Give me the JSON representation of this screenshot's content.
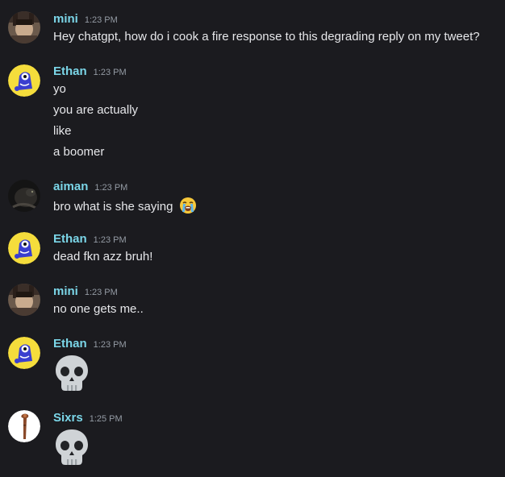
{
  "messages": [
    {
      "author": "mini",
      "avatar": "mini-avatar",
      "time": "1:23 PM",
      "lines": [
        "Hey chatgpt, how do i cook a fire response to this degrading reply on my tweet?"
      ]
    },
    {
      "author": "Ethan",
      "avatar": "ethan-avatar",
      "time": "1:23 PM",
      "lines": [
        "yo",
        "you are actually",
        "like",
        "a boomer"
      ]
    },
    {
      "author": "aiman",
      "avatar": "aiman-avatar",
      "time": "1:23 PM",
      "lines": [
        "bro what is she saying"
      ],
      "emoji": "loudly-crying-face-emoji"
    },
    {
      "author": "Ethan",
      "avatar": "ethan-avatar",
      "time": "1:23 PM",
      "lines": [
        "dead fkn azz bruh!"
      ]
    },
    {
      "author": "mini",
      "avatar": "mini-avatar",
      "time": "1:23 PM",
      "lines": [
        "no one gets me.."
      ]
    },
    {
      "author": "Ethan",
      "avatar": "ethan-avatar",
      "time": "1:23 PM",
      "emoji": "skull-emoji"
    },
    {
      "author": "Sixrs",
      "avatar": "sixrs-avatar",
      "time": "1:25 PM",
      "emoji": "skull-emoji"
    }
  ],
  "colors": {
    "background": "#1b1b1f",
    "author_name": "#7bd6e8",
    "message_text": "#e6e7ea",
    "timestamp": "#949ba4"
  }
}
